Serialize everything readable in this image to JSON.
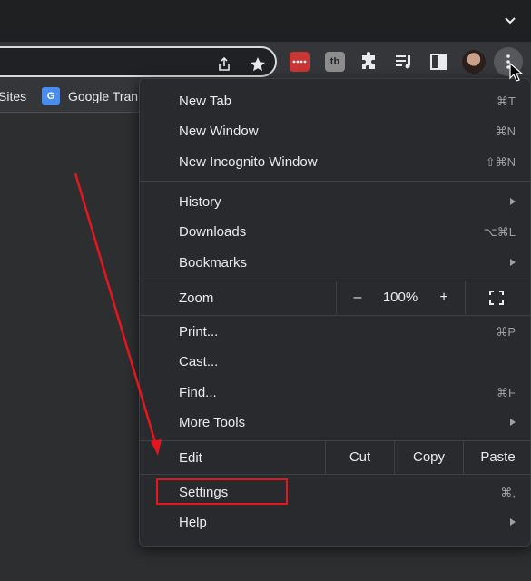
{
  "toolbar": {
    "extension_gray_label": "tb"
  },
  "bookmarks": {
    "items": [
      {
        "label": "Sites"
      },
      {
        "label": "Google Tran",
        "icon": "google-translate-icon"
      }
    ]
  },
  "menu": {
    "new_tab": {
      "label": "New Tab",
      "shortcut": "⌘T"
    },
    "new_window": {
      "label": "New Window",
      "shortcut": "⌘N"
    },
    "new_incognito": {
      "label": "New Incognito Window",
      "shortcut": "⇧⌘N"
    },
    "history": {
      "label": "History"
    },
    "downloads": {
      "label": "Downloads",
      "shortcut": "⌥⌘L"
    },
    "bookmarks": {
      "label": "Bookmarks"
    },
    "zoom": {
      "label": "Zoom",
      "minus": "–",
      "value": "100%",
      "plus": "+"
    },
    "print": {
      "label": "Print...",
      "shortcut": "⌘P"
    },
    "cast": {
      "label": "Cast..."
    },
    "find": {
      "label": "Find...",
      "shortcut": "⌘F"
    },
    "more_tools": {
      "label": "More Tools"
    },
    "edit": {
      "label": "Edit",
      "cut": "Cut",
      "copy": "Copy",
      "paste": "Paste"
    },
    "settings": {
      "label": "Settings",
      "shortcut": "⌘,"
    },
    "help": {
      "label": "Help"
    }
  },
  "annotation": {
    "color": "#e5161e"
  }
}
